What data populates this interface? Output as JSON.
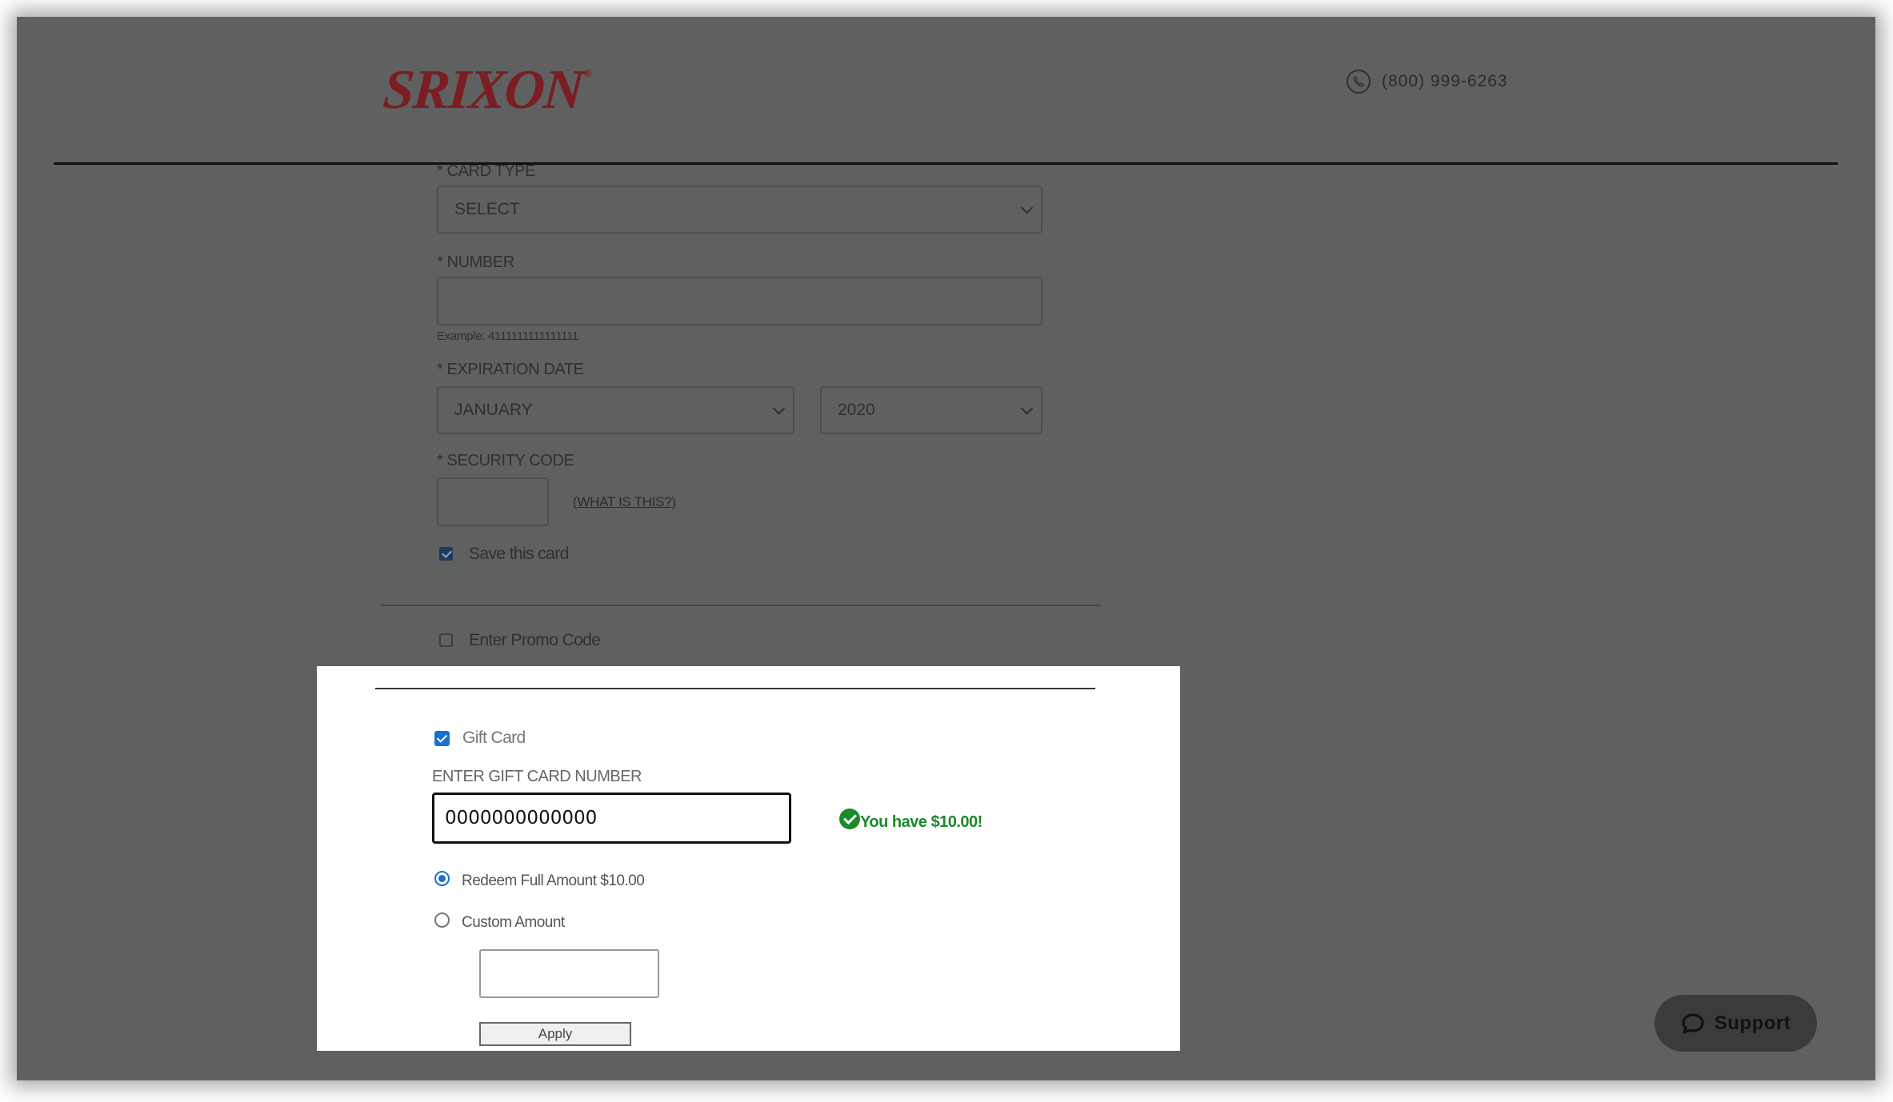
{
  "header": {
    "brand": "SRIXON",
    "brand_mark": "®",
    "phone_icon": "phone-icon",
    "phone": "(800) 999-6263"
  },
  "payment_form": {
    "card_type_label": "* CARD TYPE",
    "card_type_value": "SELECT",
    "number_label": "* NUMBER",
    "number_value": "",
    "number_hint": "Example: 4111111111111111",
    "expiration_label": "* EXPIRATION DATE",
    "exp_month_value": "JANUARY",
    "exp_year_value": "2020",
    "security_code_label": "* SECURITY CODE",
    "security_code_value": "",
    "what_is_this": "(WHAT IS THIS?)",
    "save_card_label": "Save this card",
    "save_card_checked": true,
    "promo_label": "Enter Promo Code",
    "promo_checked": false
  },
  "gift_card": {
    "checkbox_label": "Gift Card",
    "checked": true,
    "number_label": "ENTER GIFT CARD NUMBER",
    "number_value": "0000000000000",
    "balance_message": "You have $10.00!",
    "option_full_label": "Redeem Full Amount $10.00",
    "option_full_selected": true,
    "option_custom_label": "Custom Amount",
    "option_custom_selected": false,
    "custom_amount_value": "",
    "apply_label": "Apply"
  },
  "support": {
    "icon": "chat-bubble-icon",
    "label": "Support"
  },
  "colors": {
    "overlay": "#5f6160",
    "brand": "#7a1e23",
    "accent": "#1a6fd3",
    "success": "#1a8a2a"
  }
}
